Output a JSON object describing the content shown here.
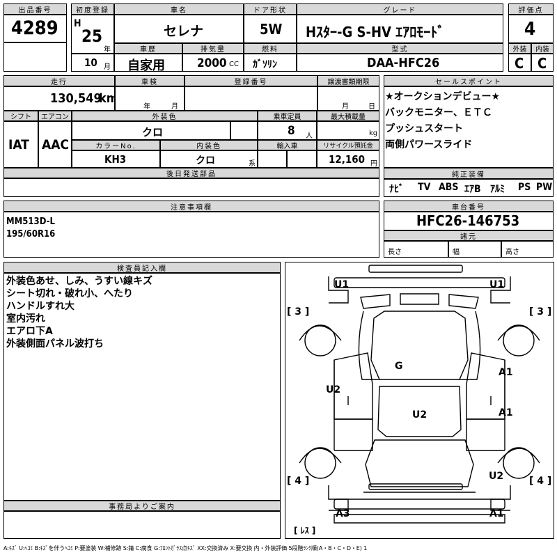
{
  "header": {
    "lot_no_label": "出品番号",
    "lot_no": "4289",
    "first_reg_label": "初度登録",
    "era": "H",
    "year": "25",
    "year_unit": "年",
    "month": "10",
    "month_unit": "月",
    "car_name_label": "車名",
    "car_name": "セレナ",
    "door_label": "ドア形状",
    "door": "5W",
    "grade_label": "グレード",
    "grade": "Hｽﾀｰ-G S-HV ｴｱﾛﾓｰﾄﾞ",
    "score_label": "評価点",
    "score": "4",
    "history_label": "車歴",
    "history": "自家用",
    "displacement_label": "排気量",
    "displacement": "2000",
    "displacement_unit": "CC",
    "fuel_label": "燃料",
    "fuel": "ｶﾞｿﾘﾝ",
    "model_label": "型式",
    "model": "DAA-HFC26",
    "exterior_label": "外装",
    "exterior_grade": "C",
    "interior_label": "内装",
    "interior_grade": "C"
  },
  "row2": {
    "mileage_label": "走行",
    "mileage": "130,549",
    "mileage_unit": "km",
    "inspection_label": "車検",
    "insp_year_unit": "年",
    "insp_month_unit": "月",
    "reg_no_label": "登録番号",
    "transfer_label": "譲渡書類期限",
    "transfer_month_unit": "月",
    "transfer_day_unit": "日",
    "shift_label": "シフト",
    "shift": "IAT",
    "ac_label": "エアコン",
    "ac": "AAC",
    "color_label": "外装色",
    "color": "クロ",
    "capacity_label": "乗車定員",
    "capacity": "8",
    "capacity_unit": "人",
    "max_load_label": "最大積載量",
    "max_load_unit": "kg",
    "color_no_label": "カラーNo.",
    "color_no": "KH3",
    "int_color_label": "内装色",
    "int_color": "クロ",
    "int_color_unit": "系",
    "import_label": "輸入車",
    "recycle_label": "リサイクル預託金",
    "recycle": "12,160",
    "recycle_unit": "円",
    "later_label": "後日発送部品"
  },
  "sales": {
    "label": "セールスポイント",
    "lines": [
      "★オークションデビュー★",
      "バックモニター、ＥＴＣ",
      "プッシュスタート",
      "両側パワースライド"
    ]
  },
  "equipment": {
    "label": "純正装備",
    "items": [
      "ﾅﾋﾞ",
      "TV",
      "ABS",
      "ｴｱB",
      "ｱﾙﾐ",
      "PS",
      "PW"
    ]
  },
  "caution": {
    "label": "注意事項欄",
    "lines": [
      "MM513D-L",
      "195/60R16"
    ]
  },
  "chassis": {
    "label": "車台番号",
    "value": "HFC26-146753",
    "specs_label": "諸元",
    "length_label": "長さ",
    "width_label": "幅",
    "height_label": "高さ"
  },
  "inspector": {
    "label": "検査員記入欄",
    "lines": [
      "外装色あせ、しみ、うすい線キズ",
      "シート切れ・破れ小、へたり",
      "ハンドルすれ大",
      "室内汚れ",
      "エアロ下A",
      "外装側面パネル波打ち"
    ]
  },
  "office": {
    "label": "事務局よりご案内"
  },
  "diagram": {
    "marks": {
      "u1_left": "U1",
      "u1_right": "U1",
      "b3_left": "[ 3 ]",
      "b3_right": "[ 3 ]",
      "g": "G",
      "u2_left": "U2",
      "a1_upper": "A1",
      "a1_lower": "A1",
      "u2_center": "U2",
      "b4_left": "[ 4 ]",
      "b4_right": "[ 4 ]",
      "u2_right": "U2",
      "a3": "A3",
      "a1_bottom": "A1",
      "less": "[ ﾚｽ ]"
    }
  },
  "legend": "A:ｷｽﾞ U:ﾍｺﾐ B:ｷｽﾞを伴うﾍｺﾐ P:要塗装 W:補修跡 S:錆 C:腐食 G:ﾌﾛﾝﾄｶﾞﾗｽ点ｷｽﾞ XX:交換済み X:要交換 内・外装評価 5段階ﾗﾝｸ順(A・B・C・D・E) 1"
}
